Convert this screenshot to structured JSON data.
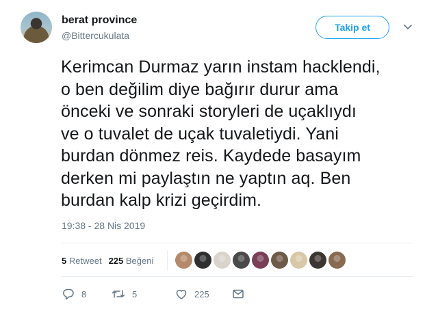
{
  "author": {
    "display_name": "berat province",
    "handle": "@Bittercukulata"
  },
  "follow_button": {
    "label": "Takip et"
  },
  "tweet": {
    "text": "Kerimcan Durmaz yarın instam hacklendi,\no ben değilim diye bağırır durur ama\nönceki ve sonraki storyleri de uçaklıydı\nve o tuvalet de uçak tuvaletiydi. Yani\nburdan dönmez reis. Kaydede basayım\nderken mi paylaştın ne yaptın aq. Ben\nburdan kalp krizi geçirdim.",
    "timestamp": "19:38 - 28 Nis 2019"
  },
  "stats": {
    "retweet_count": "5",
    "retweet_label": "Retweet",
    "like_count": "225",
    "like_label": "Beğeni"
  },
  "liker_avatars": [
    {
      "color": "#b48a6a"
    },
    {
      "color": "#2f2f2f"
    },
    {
      "color": "#d9d3cb"
    },
    {
      "color": "#4a4a4a"
    },
    {
      "color": "#7a3f57"
    },
    {
      "color": "#6e5a48"
    },
    {
      "color": "#d8c8a8"
    },
    {
      "color": "#3c3633"
    },
    {
      "color": "#8a6a4f"
    }
  ],
  "actions": {
    "reply_count": "8",
    "retweet_count": "5",
    "like_count": "225"
  },
  "colors": {
    "accent": "#1da1f2",
    "secondary_text": "#657786",
    "divider": "#e6ecf0"
  },
  "icons": [
    "chevron-down-icon",
    "reply-icon",
    "retweet-icon",
    "like-icon",
    "direct-message-icon"
  ]
}
